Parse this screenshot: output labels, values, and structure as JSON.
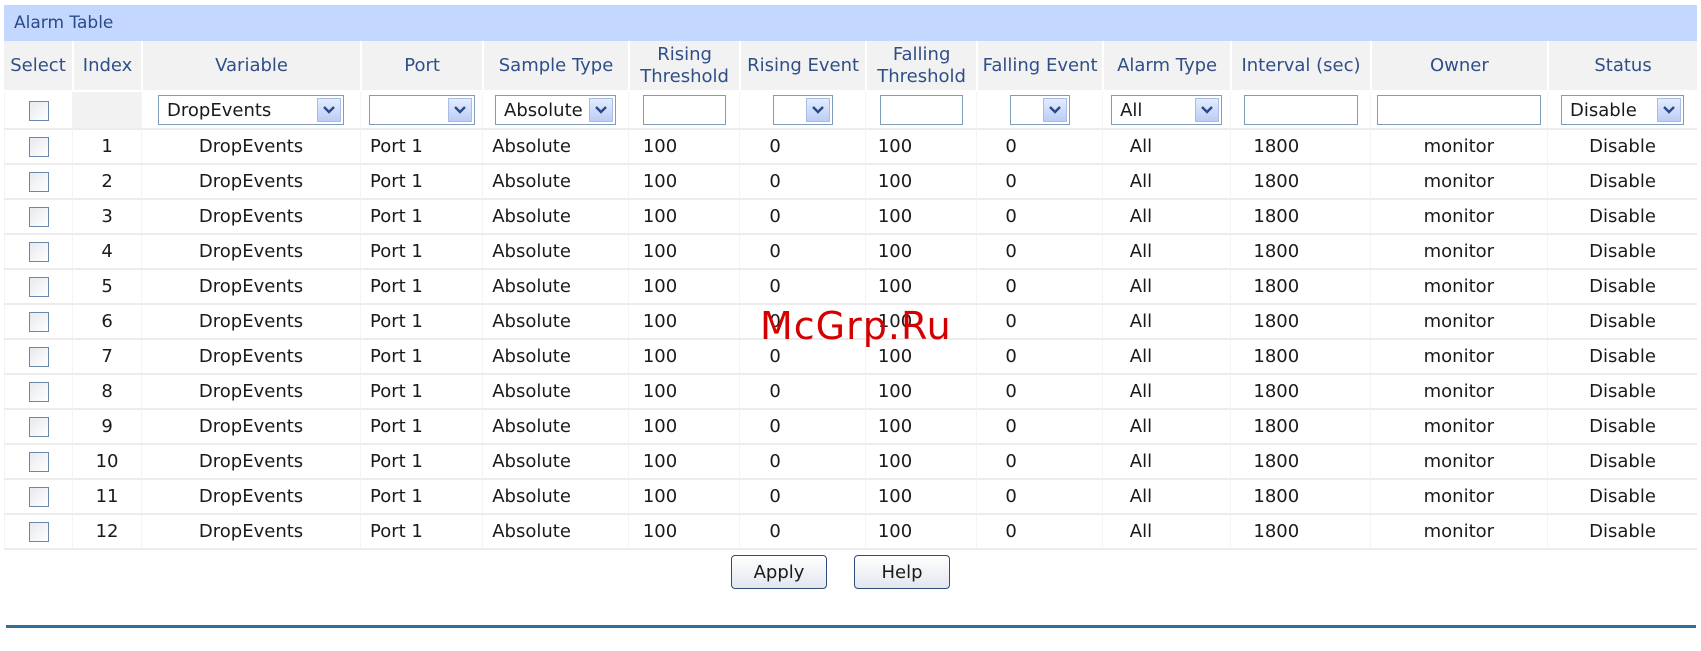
{
  "panel": {
    "title": "Alarm Table"
  },
  "columns": [
    {
      "key": "select",
      "label": "Select"
    },
    {
      "key": "index",
      "label": "Index"
    },
    {
      "key": "variable",
      "label": "Variable"
    },
    {
      "key": "port",
      "label": "Port"
    },
    {
      "key": "sample_type",
      "label": "Sample Type"
    },
    {
      "key": "rising_threshold",
      "label": "Rising\nThreshold"
    },
    {
      "key": "rising_event",
      "label": "Rising Event"
    },
    {
      "key": "falling_threshold",
      "label": "Falling\nThreshold"
    },
    {
      "key": "falling_event",
      "label": "Falling Event"
    },
    {
      "key": "alarm_type",
      "label": "Alarm Type"
    },
    {
      "key": "interval",
      "label": "Interval (sec)"
    },
    {
      "key": "owner",
      "label": "Owner"
    },
    {
      "key": "status",
      "label": "Status"
    }
  ],
  "filter": {
    "variable": "DropEvents",
    "port": "",
    "sample_type": "Absolute",
    "rising_threshold": "",
    "rising_event": "",
    "falling_threshold": "",
    "falling_event": "",
    "alarm_type": "All",
    "interval": "",
    "owner": "",
    "status": "Disable"
  },
  "rows": [
    {
      "index": "1",
      "variable": "DropEvents",
      "port": "Port 1",
      "sample_type": "Absolute",
      "rising_threshold": "100",
      "rising_event": "0",
      "falling_threshold": "100",
      "falling_event": "0",
      "alarm_type": "All",
      "interval": "1800",
      "owner": "monitor",
      "status": "Disable"
    },
    {
      "index": "2",
      "variable": "DropEvents",
      "port": "Port 1",
      "sample_type": "Absolute",
      "rising_threshold": "100",
      "rising_event": "0",
      "falling_threshold": "100",
      "falling_event": "0",
      "alarm_type": "All",
      "interval": "1800",
      "owner": "monitor",
      "status": "Disable"
    },
    {
      "index": "3",
      "variable": "DropEvents",
      "port": "Port 1",
      "sample_type": "Absolute",
      "rising_threshold": "100",
      "rising_event": "0",
      "falling_threshold": "100",
      "falling_event": "0",
      "alarm_type": "All",
      "interval": "1800",
      "owner": "monitor",
      "status": "Disable"
    },
    {
      "index": "4",
      "variable": "DropEvents",
      "port": "Port 1",
      "sample_type": "Absolute",
      "rising_threshold": "100",
      "rising_event": "0",
      "falling_threshold": "100",
      "falling_event": "0",
      "alarm_type": "All",
      "interval": "1800",
      "owner": "monitor",
      "status": "Disable"
    },
    {
      "index": "5",
      "variable": "DropEvents",
      "port": "Port 1",
      "sample_type": "Absolute",
      "rising_threshold": "100",
      "rising_event": "0",
      "falling_threshold": "100",
      "falling_event": "0",
      "alarm_type": "All",
      "interval": "1800",
      "owner": "monitor",
      "status": "Disable"
    },
    {
      "index": "6",
      "variable": "DropEvents",
      "port": "Port 1",
      "sample_type": "Absolute",
      "rising_threshold": "100",
      "rising_event": "0",
      "falling_threshold": "100",
      "falling_event": "0",
      "alarm_type": "All",
      "interval": "1800",
      "owner": "monitor",
      "status": "Disable"
    },
    {
      "index": "7",
      "variable": "DropEvents",
      "port": "Port 1",
      "sample_type": "Absolute",
      "rising_threshold": "100",
      "rising_event": "0",
      "falling_threshold": "100",
      "falling_event": "0",
      "alarm_type": "All",
      "interval": "1800",
      "owner": "monitor",
      "status": "Disable"
    },
    {
      "index": "8",
      "variable": "DropEvents",
      "port": "Port 1",
      "sample_type": "Absolute",
      "rising_threshold": "100",
      "rising_event": "0",
      "falling_threshold": "100",
      "falling_event": "0",
      "alarm_type": "All",
      "interval": "1800",
      "owner": "monitor",
      "status": "Disable"
    },
    {
      "index": "9",
      "variable": "DropEvents",
      "port": "Port 1",
      "sample_type": "Absolute",
      "rising_threshold": "100",
      "rising_event": "0",
      "falling_threshold": "100",
      "falling_event": "0",
      "alarm_type": "All",
      "interval": "1800",
      "owner": "monitor",
      "status": "Disable"
    },
    {
      "index": "10",
      "variable": "DropEvents",
      "port": "Port 1",
      "sample_type": "Absolute",
      "rising_threshold": "100",
      "rising_event": "0",
      "falling_threshold": "100",
      "falling_event": "0",
      "alarm_type": "All",
      "interval": "1800",
      "owner": "monitor",
      "status": "Disable"
    },
    {
      "index": "11",
      "variable": "DropEvents",
      "port": "Port 1",
      "sample_type": "Absolute",
      "rising_threshold": "100",
      "rising_event": "0",
      "falling_threshold": "100",
      "falling_event": "0",
      "alarm_type": "All",
      "interval": "1800",
      "owner": "monitor",
      "status": "Disable"
    },
    {
      "index": "12",
      "variable": "DropEvents",
      "port": "Port 1",
      "sample_type": "Absolute",
      "rising_threshold": "100",
      "rising_event": "0",
      "falling_threshold": "100",
      "falling_event": "0",
      "alarm_type": "All",
      "interval": "1800",
      "owner": "monitor",
      "status": "Disable"
    }
  ],
  "buttons": {
    "apply": "Apply",
    "help": "Help"
  },
  "watermark": "McGrp.Ru",
  "icons": {
    "dropdown": "chevron-down-icon",
    "checkbox": "checkbox-icon"
  },
  "colors": {
    "title_bar": "#c4d8ff",
    "header_text": "#2f4f88",
    "footer_rule": "#2f6f9b",
    "watermark": "#d40000"
  }
}
